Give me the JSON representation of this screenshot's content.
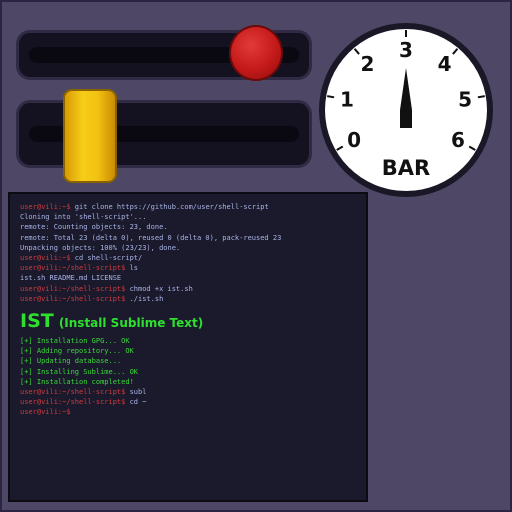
{
  "sliders": {
    "top": {
      "color": "#d11a1a",
      "level": 0.92
    },
    "bottom": {
      "color": "#f2c212",
      "level": 0.12
    }
  },
  "gauge": {
    "unit_label": "BAR",
    "ticks": [
      "0",
      "1",
      "2",
      "3",
      "4",
      "5",
      "6"
    ],
    "value": 3
  },
  "terminal": {
    "lines_before": [
      {
        "prompt": "user@vili:~$",
        "text": " git clone https://github.com/user/shell-script"
      },
      {
        "prompt": "",
        "text": "Cloning into 'shell-script'..."
      },
      {
        "prompt": "",
        "text": "remote: Counting objects: 23, done."
      },
      {
        "prompt": "",
        "text": "remote: Total 23 (delta 0), reused 0 (delta 0), pack-reused 23"
      },
      {
        "prompt": "",
        "text": "Unpacking objects: 100% (23/23), done."
      },
      {
        "prompt": "user@vili:~$",
        "text": " cd shell-script/"
      },
      {
        "prompt": "user@vili:~/shell-script$",
        "text": " ls"
      },
      {
        "prompt": "",
        "text": "ist.sh  README.md  LICENSE"
      },
      {
        "prompt": "user@vili:~/shell-script$",
        "text": " chmod +x ist.sh"
      },
      {
        "prompt": "user@vili:~/shell-script$",
        "text": " ./ist.sh"
      }
    ],
    "heading_big": "IST",
    "heading_small": "(Install Sublime Text)",
    "ok_lines": [
      "[+] Installation GPG... OK",
      "[+] Adding repository... OK",
      "[+] Updating database...",
      "[+] Installing Sublime... OK",
      "[+] Installation completed!"
    ],
    "lines_after": [
      {
        "prompt": "user@vili:~/shell-script$",
        "text": " subl"
      },
      {
        "prompt": "user@vili:~/shell-script$",
        "text": " cd ~"
      },
      {
        "prompt": "user@vili:~$",
        "text": ""
      }
    ]
  }
}
